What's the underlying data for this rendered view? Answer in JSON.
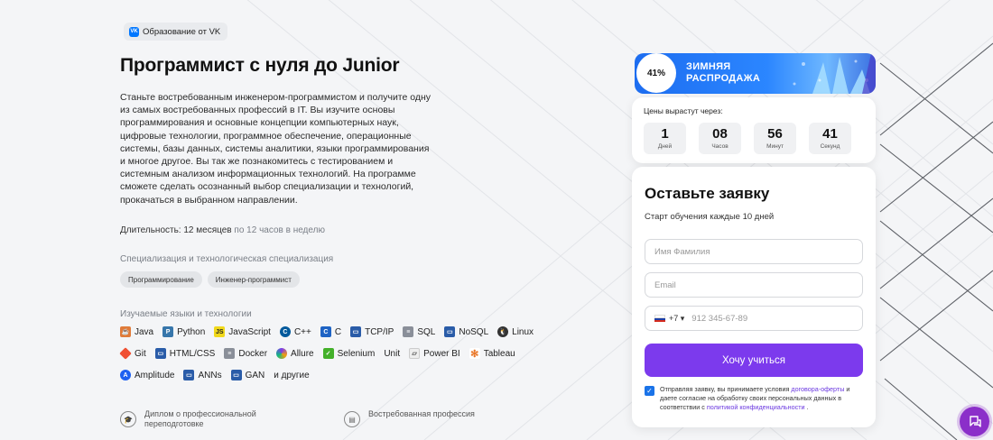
{
  "badge": {
    "text": "Образование от VK",
    "logo_text": "VK"
  },
  "title": "Программист с нуля до Junior",
  "description": "Станьте востребованным инженером-программистом и получите одну из самых востребованных профессий в IT. Вы изучите основы программирования и основные концепции компьютерных наук, цифровые технологии, программное обеспечение, операционные системы, базы данных, системы аналитики, языки программирования и многое другое. Вы так же познакомитесь с тестированием и системным анализом информационных технологий. На программе сможете сделать осознанный выбор специализации и технологий, прокачаться в выбранном направлении.",
  "duration": {
    "label": "Длительность:",
    "value": "12 месяцев",
    "hours": "по 12 часов в неделю"
  },
  "specialization": {
    "label": "Специализация и технологическая специализация",
    "chips": [
      "Программирование",
      "Инженер-программист"
    ]
  },
  "technologies": {
    "label": "Изучаемые языки и технологии",
    "row1": [
      {
        "name": "Java",
        "icon": "java-icon"
      },
      {
        "name": "Python",
        "icon": "python-icon"
      },
      {
        "name": "JavaScript",
        "icon": "javascript-icon"
      },
      {
        "name": "C++",
        "icon": "cpp-icon"
      },
      {
        "name": "C",
        "icon": "c-icon"
      },
      {
        "name": "TCP/IP",
        "icon": "network-icon"
      },
      {
        "name": "SQL",
        "icon": "database-icon"
      },
      {
        "name": "NoSQL",
        "icon": "nosql-icon"
      },
      {
        "name": "Linux",
        "icon": "linux-icon"
      }
    ],
    "row2": [
      {
        "name": "Git",
        "icon": "git-icon"
      },
      {
        "name": "HTML/CSS",
        "icon": "html-icon"
      },
      {
        "name": "Docker",
        "icon": "docker-icon"
      },
      {
        "name": "Allure",
        "icon": "allure-icon"
      },
      {
        "name": "Selenium",
        "icon": "selenium-icon"
      },
      {
        "name": "Unit",
        "icon": ""
      },
      {
        "name": "Power BI",
        "icon": "powerbi-icon"
      },
      {
        "name": "Tableau",
        "icon": "tableau-icon"
      }
    ],
    "row3": [
      {
        "name": "Amplitude",
        "icon": "amplitude-icon"
      },
      {
        "name": "ANNs",
        "icon": "ann-icon"
      },
      {
        "name": "GAN",
        "icon": "gan-icon"
      },
      {
        "name": "и другие",
        "icon": ""
      }
    ]
  },
  "features": [
    {
      "text": "Диплом о профессиональной переподготовке",
      "icon": "diploma-icon"
    },
    {
      "text": "Востребованная профессия",
      "icon": "profession-icon"
    }
  ],
  "sale": {
    "percent": "41%",
    "line1": "ЗИМНЯЯ",
    "line2": "РАСПРОДАЖА"
  },
  "timer": {
    "label": "Цены вырастут через:",
    "units": [
      {
        "value": "1",
        "label": "Дней"
      },
      {
        "value": "08",
        "label": "Часов"
      },
      {
        "value": "56",
        "label": "Минут"
      },
      {
        "value": "41",
        "label": "Секунд"
      }
    ]
  },
  "form": {
    "title": "Оставьте заявку",
    "subtitle": "Старт обучения каждые 10 дней",
    "name_placeholder": "Имя Фамилия",
    "email_placeholder": "Email",
    "phone_code": "+7",
    "phone_placeholder": "912 345-67-89",
    "submit_label": "Хочу учиться",
    "consent_1": "Отправляя заявку, вы принимаете условия ",
    "consent_link_1": "договора-оферты",
    "consent_2": " и даете согласие на обработку своих персональных данных в соответствии с ",
    "consent_link_2": "политикой конфиденциальности",
    "consent_3": " ."
  },
  "colors": {
    "accent": "#7c3aed",
    "banner": "#2b86ff",
    "chat": "#8b2fc9"
  }
}
